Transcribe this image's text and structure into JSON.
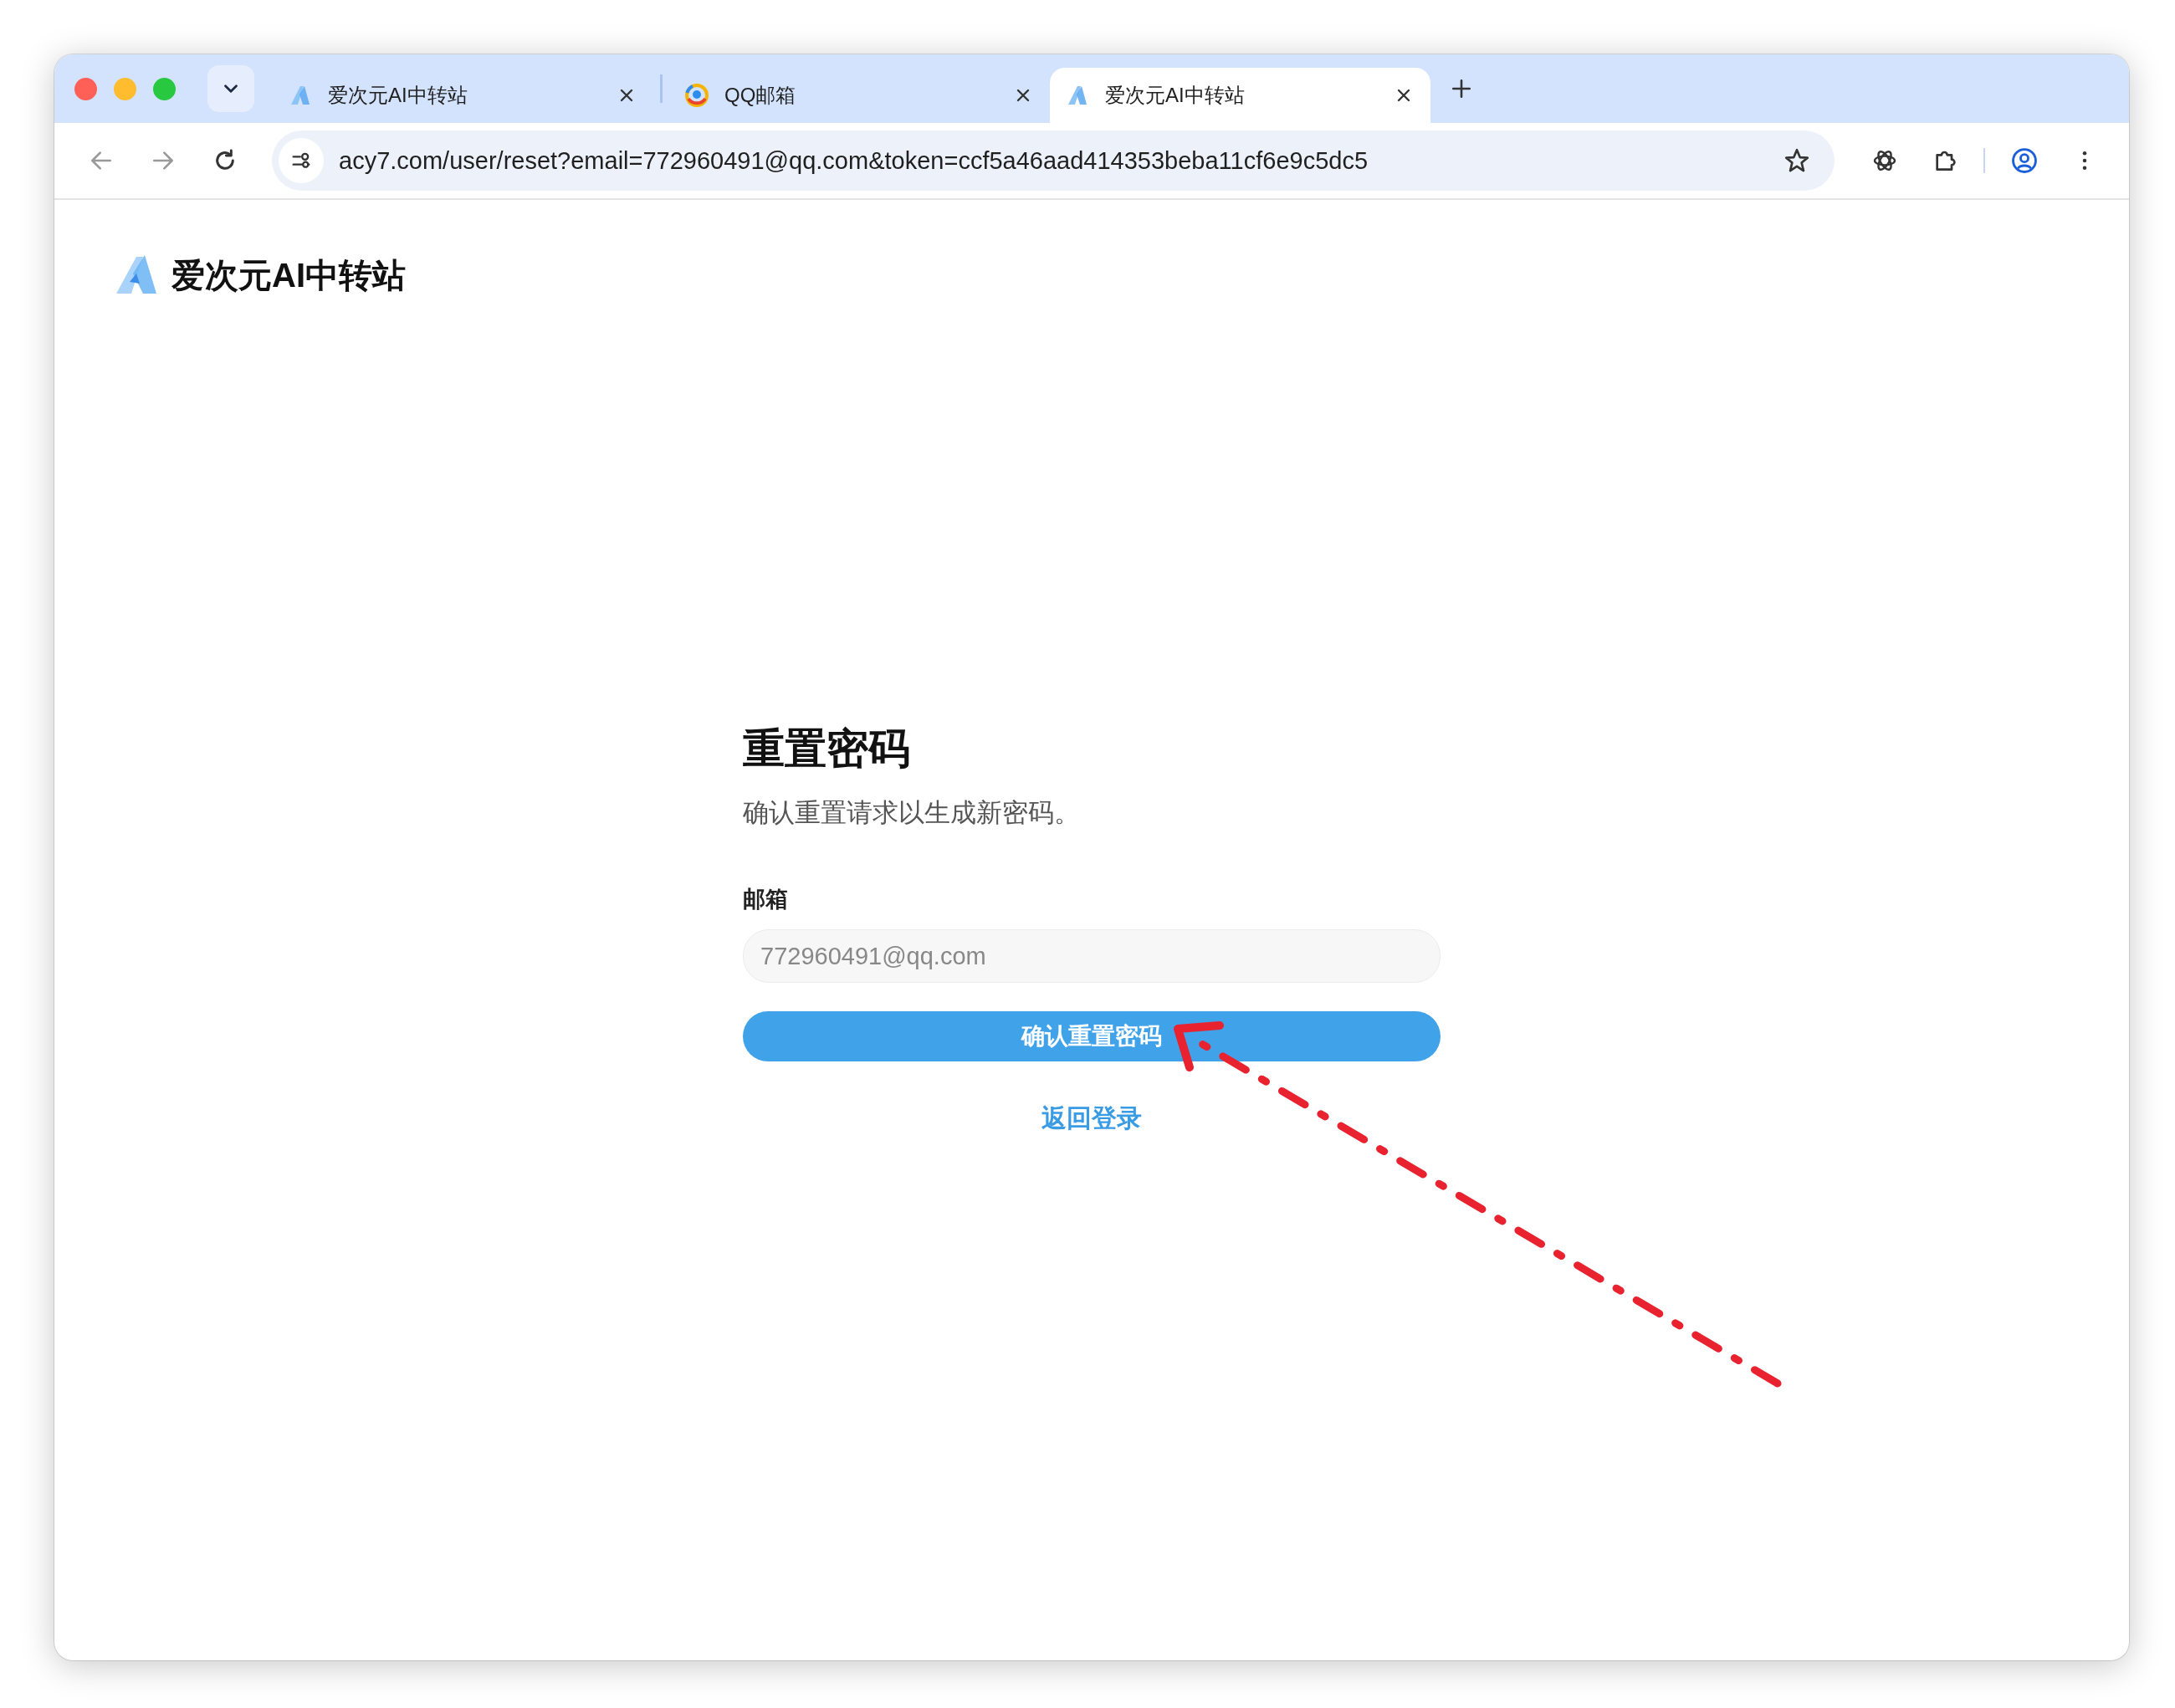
{
  "browser": {
    "tabs": [
      {
        "title": "爱次元AI中转站",
        "kind": "site",
        "selected": false
      },
      {
        "title": "QQ邮箱",
        "kind": "mail",
        "selected": false
      },
      {
        "title": "爱次元AI中转站",
        "kind": "site",
        "selected": true
      }
    ],
    "address": "acy7.com/user/reset?email=772960491@qq.com&token=ccf5a46aad414353beba11cf6e9c5dc5"
  },
  "page": {
    "brand": "爱次元AI中转站",
    "title": "重置密码",
    "subtitle": "确认重置请求以生成新密码。",
    "fields": [
      {
        "label": "邮箱",
        "value": "772960491@qq.com",
        "disabled": true
      }
    ],
    "submit": "确认重置密码",
    "link": "返回登录"
  }
}
